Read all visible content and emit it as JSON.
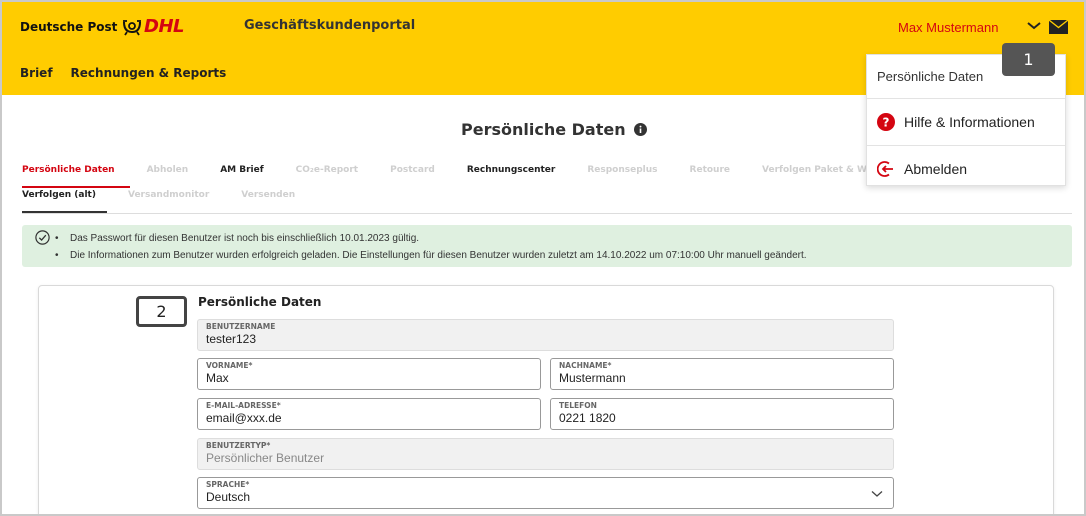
{
  "header": {
    "brand": "Deutsche Post",
    "dhl": "DHL",
    "portal_title": "Geschäftskundenportal",
    "nav": [
      "Brief",
      "Rechnungen & Reports"
    ],
    "username": "Max Mustermann"
  },
  "dropdown": {
    "items": [
      "Persönliche Daten",
      "Hilfe & Informationen",
      "Abmelden"
    ]
  },
  "badges": {
    "one": "1",
    "two": "2"
  },
  "page_title": "Persönliche Daten",
  "tabs_row1": [
    "Persönliche Daten",
    "Abholen",
    "AM Brief",
    "CO₂e-Report",
    "Postcard",
    "Rechnungscenter",
    "Responseplus",
    "Retoure",
    "Verfolgen Paket & Waren"
  ],
  "tabs_row2": [
    "Verfolgen (alt)",
    "Versandmonitor",
    "Versenden"
  ],
  "alert": {
    "lines": [
      "Das Passwort für diesen Benutzer ist noch bis einschließlich 10.01.2023 gültig.",
      "Die Informationen zum Benutzer wurden erfolgreich geladen. Die Einstellungen für diesen Benutzer wurden zuletzt am 14.10.2022 um 07:10:00 Uhr manuell geändert."
    ]
  },
  "form": {
    "title": "Persönliche Daten",
    "benutzername": {
      "label": "BENUTZERNAME",
      "value": "tester123"
    },
    "vorname": {
      "label": "VORNAME*",
      "value": "Max"
    },
    "nachname": {
      "label": "NACHNAME*",
      "value": "Mustermann"
    },
    "email": {
      "label": "E-MAIL-ADRESSE*",
      "value": "email@xxx.de"
    },
    "telefon": {
      "label": "TELEFON",
      "value": "0221 1820"
    },
    "benutzertyp": {
      "label": "BENUTZERTYP*",
      "value": "Persönlicher Benutzer"
    },
    "sprache": {
      "label": "SPRACHE*",
      "value": "Deutsch"
    }
  },
  "colors": {
    "brand_yellow": "#ffcc00",
    "brand_red": "#d40511",
    "alert_bg": "#dff0e0"
  }
}
